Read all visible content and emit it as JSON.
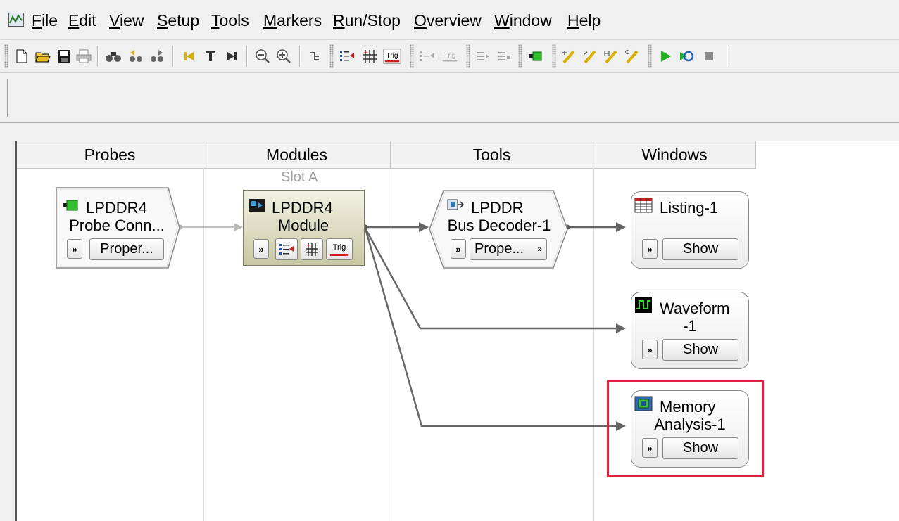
{
  "menu": [
    "File",
    "Edit",
    "View",
    "Setup",
    "Tools",
    "Markers",
    "Run/Stop",
    "Overview",
    "Window",
    "Help"
  ],
  "toolbar": {
    "trig_label": "Trig"
  },
  "columns": {
    "probes": "Probes",
    "modules": "Modules",
    "tools": "Tools",
    "windows": "Windows"
  },
  "slot_label": "Slot A",
  "probe": {
    "line1": "LPDDR4",
    "line2": "Probe Conn...",
    "button": "Proper..."
  },
  "module": {
    "line1": "LPDDR4",
    "line2": "Module",
    "trig": "Trig"
  },
  "tool": {
    "line1": "LPDDR",
    "line2": "Bus Decoder-1",
    "button": "Prope..."
  },
  "windows": [
    {
      "line1": "Listing-1",
      "line2": "",
      "button": "Show"
    },
    {
      "line1": "Waveform",
      "line2": "-1",
      "button": "Show"
    },
    {
      "line1": "Memory",
      "line2": "Analysis-1",
      "button": "Show"
    }
  ],
  "colors": {
    "highlight": "#e0203c",
    "connector": "#6a6a6a",
    "module_bg": "#d8d8b8"
  }
}
